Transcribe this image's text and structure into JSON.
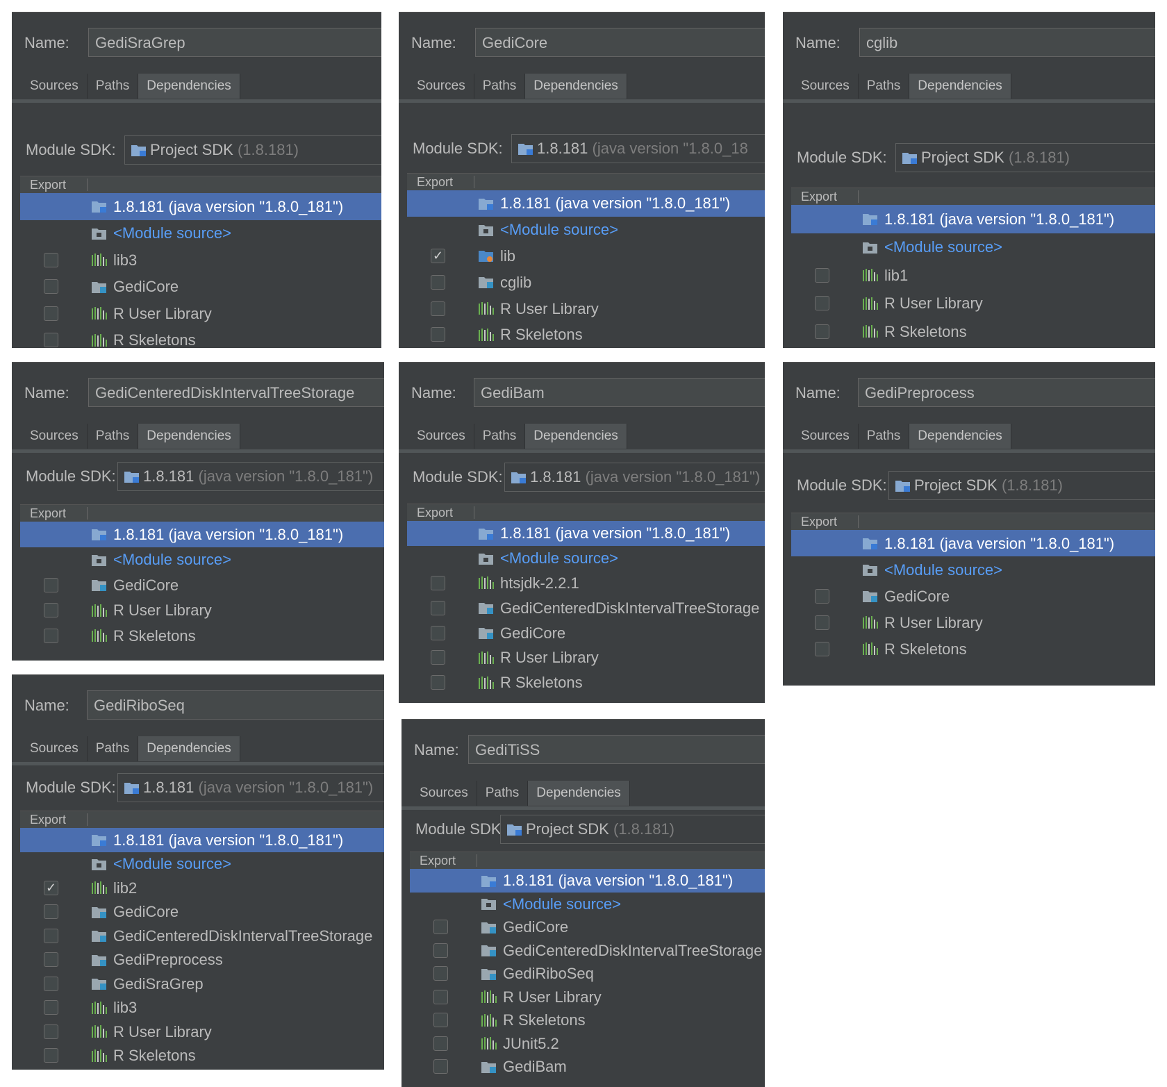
{
  "labels": {
    "name": "Name:",
    "module_sdk": "Module SDK:",
    "export_header": "Export"
  },
  "tabs": [
    "Sources",
    "Paths",
    "Dependencies"
  ],
  "active_tab": "Dependencies",
  "colors": {
    "panel_bg": "#3c3f41",
    "selection": "#4b6eaf",
    "module_source_text": "#589df6",
    "library_icon": "#6aaf50",
    "folder_icon": "#9aa7b0"
  },
  "panels": [
    {
      "name": "GediSraGrep",
      "sdk": {
        "main": "Project SDK",
        "dim": "(1.8.181)"
      },
      "rows": [
        {
          "text": "1.8.181 (java version \"1.8.0_181\")",
          "icon": "sdk-folder-icon",
          "selected": true
        },
        {
          "text": "<Module source>",
          "icon": "module-folder-icon",
          "module": true
        },
        {
          "text": "lib3",
          "icon": "library-icon",
          "checked": false
        },
        {
          "text": "GediCore",
          "icon": "module-icon",
          "checked": false
        },
        {
          "text": "R User Library",
          "icon": "library-icon",
          "checked": false
        },
        {
          "text": "R Skeletons",
          "icon": "library-icon",
          "checked": false
        }
      ]
    },
    {
      "name": "GediCore",
      "sdk": {
        "main": "1.8.181",
        "dim": "(java version \"1.8.0_18"
      },
      "rows": [
        {
          "text": "1.8.181 (java version \"1.8.0_181\")",
          "icon": "sdk-folder-icon",
          "selected": true
        },
        {
          "text": "<Module source>",
          "icon": "module-folder-icon",
          "module": true
        },
        {
          "text": "lib",
          "icon": "jar-folder-icon",
          "checked": true
        },
        {
          "text": "cglib",
          "icon": "module-icon",
          "checked": false
        },
        {
          "text": "R User Library",
          "icon": "library-icon",
          "checked": false
        },
        {
          "text": "R Skeletons",
          "icon": "library-icon",
          "checked": false
        }
      ]
    },
    {
      "name": "cglib",
      "sdk": {
        "main": "Project SDK",
        "dim": "(1.8.181)"
      },
      "rows": [
        {
          "text": "1.8.181 (java version \"1.8.0_181\")",
          "icon": "sdk-folder-icon",
          "selected": true
        },
        {
          "text": "<Module source>",
          "icon": "module-folder-icon",
          "module": true
        },
        {
          "text": "lib1",
          "icon": "library-icon",
          "checked": false
        },
        {
          "text": "R User Library",
          "icon": "library-icon",
          "checked": false
        },
        {
          "text": "R Skeletons",
          "icon": "library-icon",
          "checked": false
        }
      ]
    },
    {
      "name": "GediCenteredDiskIntervalTreeStorage",
      "sdk": {
        "main": "1.8.181",
        "dim": "(java version \"1.8.0_181\")"
      },
      "rows": [
        {
          "text": "1.8.181 (java version \"1.8.0_181\")",
          "icon": "sdk-folder-icon",
          "selected": true
        },
        {
          "text": "<Module source>",
          "icon": "module-folder-icon",
          "module": true
        },
        {
          "text": "GediCore",
          "icon": "module-icon",
          "checked": false
        },
        {
          "text": "R User Library",
          "icon": "library-icon",
          "checked": false
        },
        {
          "text": "R Skeletons",
          "icon": "library-icon",
          "checked": false
        }
      ]
    },
    {
      "name": "GediBam",
      "sdk": {
        "main": "1.8.181",
        "dim": "(java version \"1.8.0_181\")"
      },
      "rows": [
        {
          "text": "1.8.181 (java version \"1.8.0_181\")",
          "icon": "sdk-folder-icon",
          "selected": true
        },
        {
          "text": "<Module source>",
          "icon": "module-folder-icon",
          "module": true
        },
        {
          "text": "htsjdk-2.2.1",
          "icon": "library-icon",
          "checked": false
        },
        {
          "text": "GediCenteredDiskIntervalTreeStorage",
          "icon": "module-icon",
          "checked": false
        },
        {
          "text": "GediCore",
          "icon": "module-icon",
          "checked": false
        },
        {
          "text": "R User Library",
          "icon": "library-icon",
          "checked": false
        },
        {
          "text": "R Skeletons",
          "icon": "library-icon",
          "checked": false
        }
      ]
    },
    {
      "name": "GediPreprocess",
      "sdk": {
        "main": "Project SDK",
        "dim": "(1.8.181)"
      },
      "rows": [
        {
          "text": "1.8.181 (java version \"1.8.0_181\")",
          "icon": "sdk-folder-icon",
          "selected": true
        },
        {
          "text": "<Module source>",
          "icon": "module-folder-icon",
          "module": true
        },
        {
          "text": "GediCore",
          "icon": "module-icon",
          "checked": false
        },
        {
          "text": "R User Library",
          "icon": "library-icon",
          "checked": false
        },
        {
          "text": "R Skeletons",
          "icon": "library-icon",
          "checked": false
        }
      ]
    },
    {
      "name": "GediRiboSeq",
      "sdk": {
        "main": "1.8.181",
        "dim": "(java version \"1.8.0_181\")"
      },
      "rows": [
        {
          "text": "1.8.181 (java version \"1.8.0_181\")",
          "icon": "sdk-folder-icon",
          "selected": true
        },
        {
          "text": "<Module source>",
          "icon": "module-folder-icon",
          "module": true
        },
        {
          "text": "lib2",
          "icon": "library-icon",
          "checked": true
        },
        {
          "text": "GediCore",
          "icon": "module-icon",
          "checked": false
        },
        {
          "text": "GediCenteredDiskIntervalTreeStorage",
          "icon": "module-icon",
          "checked": false
        },
        {
          "text": "GediPreprocess",
          "icon": "module-icon",
          "checked": false
        },
        {
          "text": "GediSraGrep",
          "icon": "module-icon",
          "checked": false
        },
        {
          "text": "lib3",
          "icon": "library-icon",
          "checked": false
        },
        {
          "text": "R User Library",
          "icon": "library-icon",
          "checked": false
        },
        {
          "text": "R Skeletons",
          "icon": "library-icon",
          "checked": false
        }
      ]
    },
    {
      "name": "GediTiSS",
      "sdk": {
        "main": "Project SDK",
        "dim": "(1.8.181)"
      },
      "rows": [
        {
          "text": "1.8.181 (java version \"1.8.0_181\")",
          "icon": "sdk-folder-icon",
          "selected": true
        },
        {
          "text": "<Module source>",
          "icon": "module-folder-icon",
          "module": true
        },
        {
          "text": "GediCore",
          "icon": "module-icon",
          "checked": false
        },
        {
          "text": "GediCenteredDiskIntervalTreeStorage",
          "icon": "module-icon",
          "checked": false
        },
        {
          "text": "GediRiboSeq",
          "icon": "module-icon",
          "checked": false
        },
        {
          "text": "R User Library",
          "icon": "library-icon",
          "checked": false
        },
        {
          "text": "R Skeletons",
          "icon": "library-icon",
          "checked": false
        },
        {
          "text": "JUnit5.2",
          "icon": "library-icon",
          "checked": false
        },
        {
          "text": "GediBam",
          "icon": "module-icon",
          "checked": false
        }
      ]
    }
  ]
}
